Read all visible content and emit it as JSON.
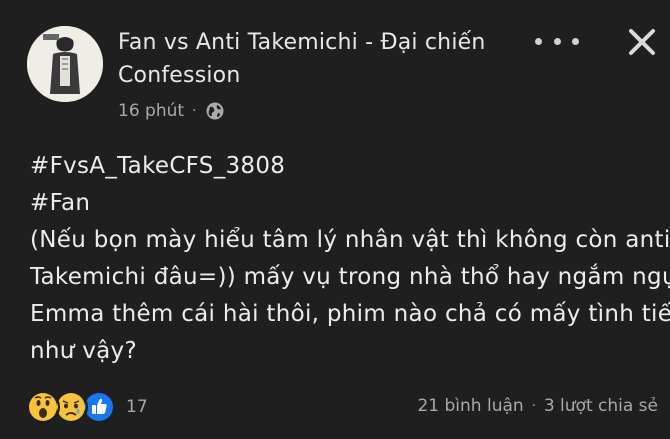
{
  "post": {
    "group_name": "Fan vs Anti Takemichi - Đại chiến Confession",
    "time": "16 phút",
    "meta_separator": "·",
    "privacy_icon": "globe-icon",
    "more_icon": "more-options-icon",
    "close_icon": "close-icon",
    "body_lines": [
      "#FvsA_TakeCFS_3808",
      "#Fan",
      "(Nếu bọn mày hiểu tâm lý nhân vật thì không còn anti",
      "Takemichi đâu=)) mấy vụ trong nhà thổ hay ngắm ngực",
      "Emma thêm cái hài thôi, phim nào chả có mấy tình tiết",
      "như vậy?"
    ]
  },
  "footer": {
    "reactions": [
      "wow-reaction-icon",
      "sad-reaction-icon",
      "like-reaction-icon"
    ],
    "reaction_count": "17",
    "comments": "21 bình luận",
    "separator": "·",
    "shares": "3 lượt chia sẻ"
  },
  "colors": {
    "background": "#1f1f20",
    "text": "#ececec",
    "secondary_text": "#a7a9ad",
    "like_blue": "#1877f2",
    "reaction_yellow": "#f7c33d"
  }
}
